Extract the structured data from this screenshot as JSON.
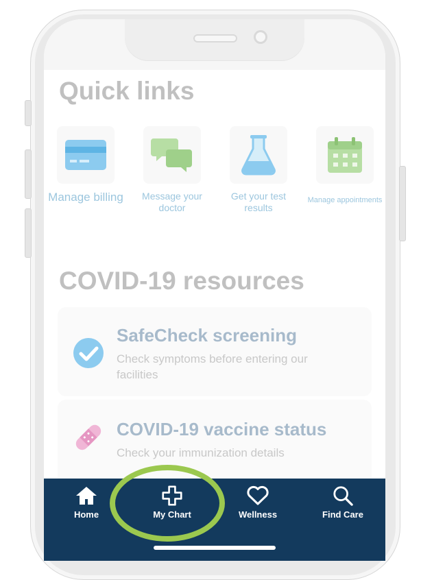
{
  "quick_links": {
    "title": "Quick links",
    "items": [
      {
        "label": "Manage billing",
        "icon": "credit-card-icon"
      },
      {
        "label": "Message your doctor",
        "icon": "chat-bubbles-icon"
      },
      {
        "label": "Get your test results",
        "icon": "flask-icon"
      },
      {
        "label": "Manage appointments",
        "icon": "calendar-icon"
      }
    ]
  },
  "covid": {
    "title": "COVID-19 resources",
    "cards": [
      {
        "title": "SafeCheck screening",
        "subtitle": "Check symptoms before entering our facilities",
        "icon": "check-circle-icon"
      },
      {
        "title": "COVID-19 vaccine status",
        "subtitle": "Check your immunization details",
        "icon": "bandage-icon"
      }
    ]
  },
  "tabbar": {
    "tabs": [
      {
        "label": "Home",
        "icon": "house-icon"
      },
      {
        "label": "My Chart",
        "icon": "plus-cross-icon"
      },
      {
        "label": "Wellness",
        "icon": "heart-icon"
      },
      {
        "label": "Find Care",
        "icon": "search-icon"
      }
    ]
  },
  "colors": {
    "tabbar_bg": "#133a5d",
    "highlight": "#9bc84f",
    "link_text": "#9cc6de"
  }
}
